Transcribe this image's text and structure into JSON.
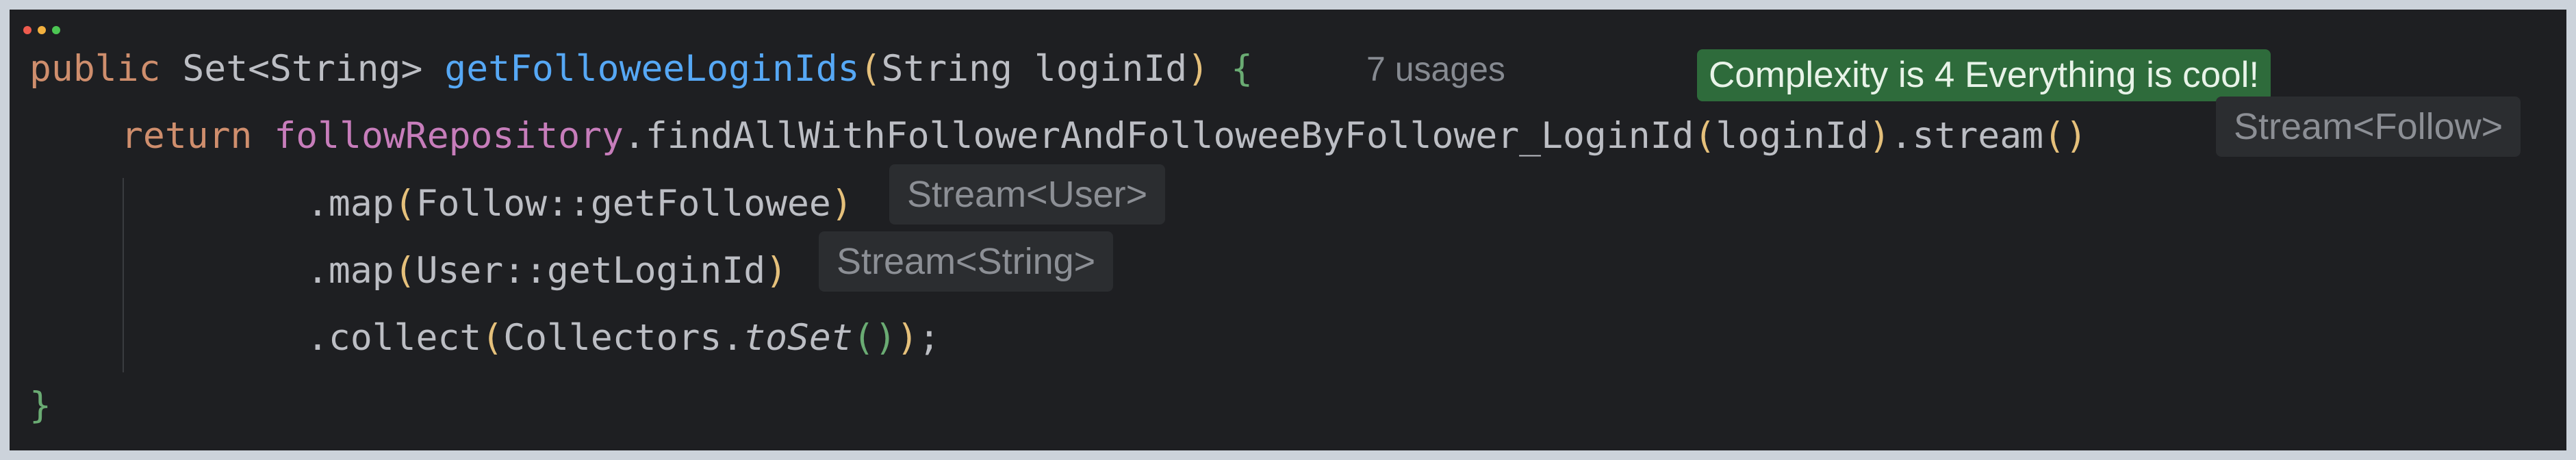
{
  "window": {
    "dot_colors": [
      "#ee5b4e",
      "#f3b13f",
      "#4cc653"
    ]
  },
  "badge": {
    "text": "Complexity is 4 Everything is cool!"
  },
  "code": {
    "line1": {
      "kw": "public",
      "type": "Set<String>",
      "fn": "getFolloweeLoginIds",
      "open": "(",
      "params": "String loginId",
      "close": ")",
      "brace": "{",
      "usages": "7 usages"
    },
    "line2": {
      "kw": "return",
      "field": "followRepository",
      "call": ".findAllWithFollowerAndFolloweeByFollower_LoginId",
      "open": "(",
      "arg": "loginId",
      "close": ")",
      "method": ".stream",
      "parens": "()",
      "hint": "Stream<Follow>"
    },
    "line3": {
      "method": ".map",
      "open": "(",
      "arg": "Follow::getFollowee",
      "close": ")",
      "hint": "Stream<User>"
    },
    "line4": {
      "method": ".map",
      "open": "(",
      "arg": "User::getLoginId",
      "close": ")",
      "hint": "Stream<String>"
    },
    "line5": {
      "method": ".collect",
      "open": "(",
      "obj": "Collectors.",
      "italic": "toSet",
      "inner": "()",
      "close": ")",
      "end": ";"
    },
    "line6": {
      "brace": "}"
    }
  }
}
